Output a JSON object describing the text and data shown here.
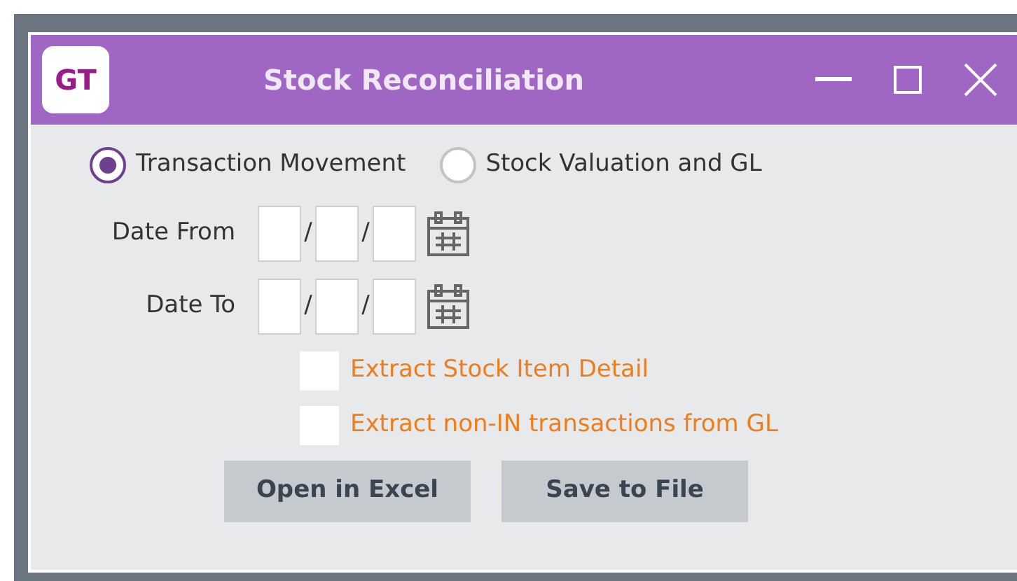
{
  "window": {
    "title": "Stock Reconciliation",
    "logo": "GT"
  },
  "modes": [
    {
      "label": "Transaction Movement",
      "selected": true
    },
    {
      "label": "Stock Valuation and GL",
      "selected": false
    }
  ],
  "dates": [
    {
      "label": "Date From",
      "separators": [
        "/",
        "/"
      ]
    },
    {
      "label": "Date To",
      "separators": [
        "/",
        "/"
      ]
    }
  ],
  "options": [
    {
      "label": "Extract Stock Item Detail",
      "checked": false
    },
    {
      "label": "Extract non-IN transactions from GL",
      "checked": false
    }
  ],
  "buttons": [
    "Open in Excel",
    "Save to File"
  ]
}
